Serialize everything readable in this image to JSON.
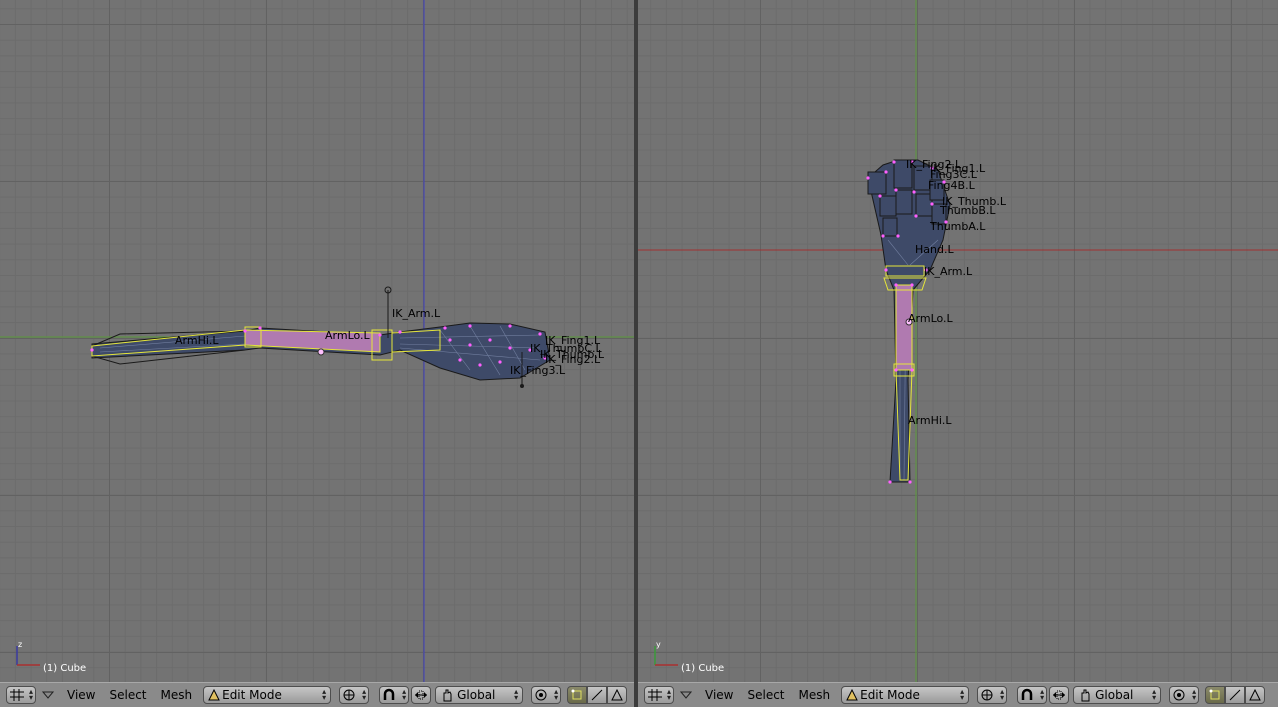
{
  "left_view": {
    "object_info": "(1) Cube",
    "bone_labels": [
      "IK_Arm.L",
      "ArmLo.L",
      "ArmHi.L",
      "IK_Fing1.L",
      "IK_Fing2.L",
      "IK_Fing3.L",
      "IK_ThumbC.L",
      "IK_Thumb.L"
    ],
    "axis_labels": {
      "vertical": "z",
      "horizontal": "x"
    }
  },
  "right_view": {
    "object_info": "(1) Cube",
    "bone_labels": [
      "IK_Fing2.L",
      "IK_Fing1.L",
      "Fing3C.L",
      "Fing4B.L",
      "IK_Thumb.L",
      "ThumbB.L",
      "ThumbA.L",
      "Hand.L",
      "IK_Arm.L",
      "ArmLo.L",
      "ArmHi.L"
    ],
    "axis_labels": {
      "vertical": "y",
      "horizontal": "x"
    }
  },
  "header_left": {
    "view_label": "View",
    "select_label": "Select",
    "mesh_label": "Mesh",
    "mode_value": "Edit Mode",
    "orientation_value": "Global"
  },
  "header_right": {
    "view_label": "View",
    "select_label": "Select",
    "mesh_label": "Mesh",
    "mode_value": "Edit Mode",
    "orientation_value": "Global"
  },
  "colors": {
    "viewport_bg": "#737373",
    "grid_line": "#626262",
    "x_axis": "#6b8f3a",
    "y_axis": "#8a3030",
    "z_axis": "#3a3aa0",
    "bone_outline": "#e6e63a",
    "bone_fill": "#b07ab0",
    "mesh_fill": "#3d4a6a",
    "vertex": "#ff60ff"
  }
}
